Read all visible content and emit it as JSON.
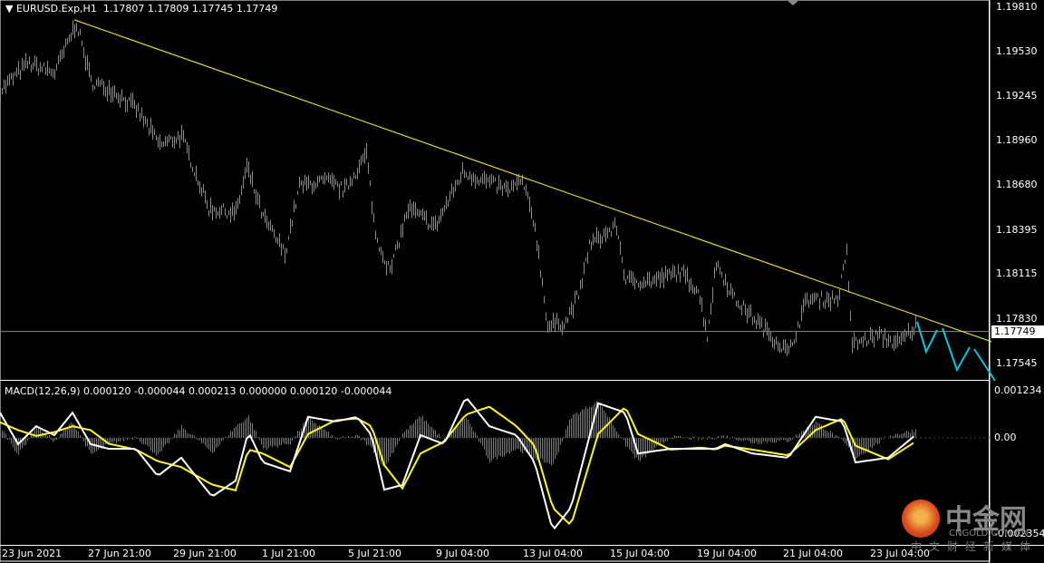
{
  "header": {
    "symbol": "EURUSD.Exp,H1",
    "open": "1.17807",
    "high": "1.17809",
    "low": "1.17745",
    "close": "1.17749"
  },
  "macd_legend": "MACD(12,26,9) 0.000120 -0.000044 0.000213 0.000000 0.000120 -0.000044",
  "price_axis": [
    "1.19810",
    "1.19530",
    "1.19245",
    "1.18960",
    "1.18680",
    "1.18395",
    "1.18115",
    "1.17830",
    "1.17545"
  ],
  "price_axis_values": [
    1.1981,
    1.1953,
    1.19245,
    1.1896,
    1.1868,
    1.18395,
    1.18115,
    1.1783,
    1.17545
  ],
  "current_price": "1.17749",
  "macd_axis": [
    "0.001234",
    "0.00",
    "-0.002354"
  ],
  "time_axis": [
    "23 Jun 2021",
    "27 Jun 21:00",
    "29 Jun 21:00",
    "1 Jul 21:00",
    "5 Jul 21:00",
    "9 Jul 04:00",
    "13 Jul 04:00",
    "15 Jul 04:00",
    "19 Jul 04:00",
    "21 Jul 04:00",
    "23 Jul 04:00"
  ],
  "watermark": {
    "name": "中金网",
    "site": "CNGOLD.COM.CN",
    "tagline": "中文财经新媒体"
  },
  "colors": {
    "bars": "#8a8a8a",
    "trendline": "#ffff00",
    "macd": "#ffffff",
    "signal": "#ffff00",
    "arrows": "#00c8e6",
    "grid": "#888888"
  },
  "chart_data": {
    "type": "line",
    "price_series": {
      "t": [
        0,
        15,
        30,
        42,
        50,
        62,
        75,
        88,
        100,
        115,
        130,
        136,
        145,
        157,
        165,
        180,
        190,
        202,
        207,
        215,
        225,
        240,
        255,
        268,
        280,
        288,
        295,
        302,
        312,
        320,
        325,
        340,
        345,
        360,
        375,
        385,
        390,
        395,
        405,
        420,
        435,
        445,
        462,
        467,
        470,
        485,
        495,
        505
      ],
      "price": [
        1.1928,
        1.19453,
        1.19395,
        1.19712,
        1.19338,
        1.1928,
        1.19165,
        1.18934,
        1.18992,
        1.18531,
        1.18503,
        1.1879,
        1.18474,
        1.18243,
        1.18675,
        1.18704,
        1.18647,
        1.18877,
        1.18358,
        1.18128,
        1.18531,
        1.18416,
        1.18762,
        1.18704,
        1.18647,
        1.18704,
        1.18416,
        1.17783,
        1.17811,
        1.18013,
        1.18301,
        1.18416,
        1.1807,
        1.1807,
        1.18128,
        1.18013,
        1.17725,
        1.18186,
        1.17955,
        1.17783,
        1.1761,
        1.17955,
        1.17955,
        1.18243,
        1.17667,
        1.17725,
        1.17667,
        1.17783
      ]
    },
    "trendline": {
      "t": [
        41,
        547
      ],
      "price": [
        1.1973,
        1.17684
      ]
    },
    "macd": {
      "t": [
        0,
        10,
        20,
        30,
        40,
        50,
        60,
        75,
        87,
        100,
        117,
        130,
        137,
        145,
        160,
        170,
        185,
        197,
        205,
        212,
        222,
        232,
        245,
        257,
        270,
        285,
        295,
        305,
        315,
        330,
        345,
        352,
        370,
        387,
        395,
        400,
        415,
        435,
        450,
        465,
        472,
        490,
        505
      ],
      "main": [
        0.00065,
        -0.00016,
        0.0003,
        7e-05,
        0.00065,
        -0.00016,
        -0.00028,
        -0.00028,
        -0.00098,
        -0.00051,
        -0.00151,
        -0.0011,
        0.00016,
        -0.00063,
        -0.00086,
        0.00054,
        0.00042,
        0.00054,
        7e-05,
        -0.00133,
        -0.00121,
        7e-05,
        -0.00016,
        0.00105,
        0.0003,
        7e-05,
        -0.00063,
        -0.00238,
        -0.00179,
        0.00089,
        0.00065,
        -0.0004,
        -0.00028,
        -0.00028,
        -0.00028,
        -0.00016,
        -0.0004,
        -0.00051,
        0.00054,
        0.00042,
        -0.00063,
        -0.00051,
        7e-05
      ],
      "signal": [
        0.0004,
        0.0002,
        5e-05,
        0.00015,
        0.0003,
        0.0002,
        -0.00015,
        -0.0003,
        -0.0006,
        -0.00075,
        -0.0012,
        -0.00135,
        -0.0003,
        -0.0004,
        -0.00075,
        0.0001,
        0.00045,
        0.0005,
        0.0003,
        -0.0007,
        -0.0013,
        -0.0004,
        -0.0001,
        0.0006,
        0.0008,
        0.0003,
        -0.0002,
        -0.0018,
        -0.00225,
        0.0001,
        0.0008,
        0.0001,
        -0.0003,
        -0.00025,
        -0.0003,
        -0.0002,
        -0.0003,
        -0.00045,
        0.0002,
        0.0005,
        -0.0002,
        -0.00055,
        -0.0001
      ]
    },
    "macd_range": [
      -0.002354,
      0.001234
    ],
    "price_range": [
      1.17545,
      1.1981
    ]
  }
}
